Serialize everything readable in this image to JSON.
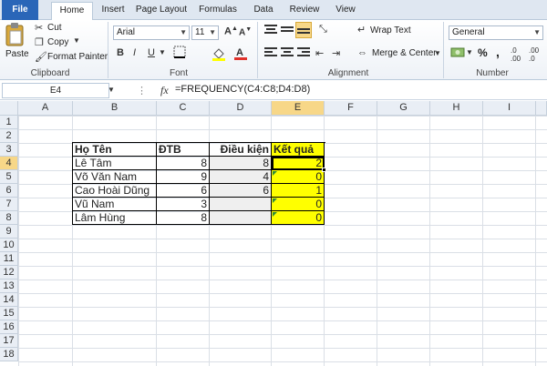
{
  "tabs": [
    "File",
    "Home",
    "Insert",
    "Page Layout",
    "Formulas",
    "Data",
    "Review",
    "View"
  ],
  "clipboard": {
    "paste": "Paste",
    "cut": "Cut",
    "copy": "Copy",
    "format_painter": "Format Painter",
    "label": "Clipboard"
  },
  "font": {
    "name": "Arial",
    "size": "11",
    "label": "Font"
  },
  "alignment": {
    "wrap_text": "Wrap Text",
    "merge_center": "Merge & Center",
    "label": "Alignment"
  },
  "number": {
    "format": "General",
    "percent": "%",
    "comma": ",",
    "label": "Number"
  },
  "formula_bar": {
    "name_box": "E4",
    "fx": "fx",
    "formula": "=FREQUENCY(C4:C8;D4:D8)"
  },
  "columns": [
    "A",
    "B",
    "C",
    "D",
    "E",
    "F",
    "G",
    "H",
    "I"
  ],
  "rows": [
    "1",
    "2",
    "3",
    "4",
    "5",
    "6",
    "7",
    "8",
    "9",
    "10",
    "11",
    "12",
    "13",
    "14",
    "15",
    "16",
    "17",
    "18"
  ],
  "table": {
    "headers": [
      "Họ Tên",
      "ĐTB",
      "Điều kiện",
      "Kết quả"
    ],
    "rows": [
      [
        "Lê Tâm",
        "8",
        "8",
        "2"
      ],
      [
        "Võ Văn Nam",
        "9",
        "4",
        "0"
      ],
      [
        "Cao Hoài Dũng",
        "6",
        "6",
        "1"
      ],
      [
        "Vũ Nam",
        "3",
        "",
        "0"
      ],
      [
        "Lâm Hùng",
        "8",
        "",
        "0"
      ]
    ]
  },
  "colors": {
    "file_tab": "#2a66b8",
    "result_fill": "#ffff00",
    "selection_header": "#f7d788"
  }
}
